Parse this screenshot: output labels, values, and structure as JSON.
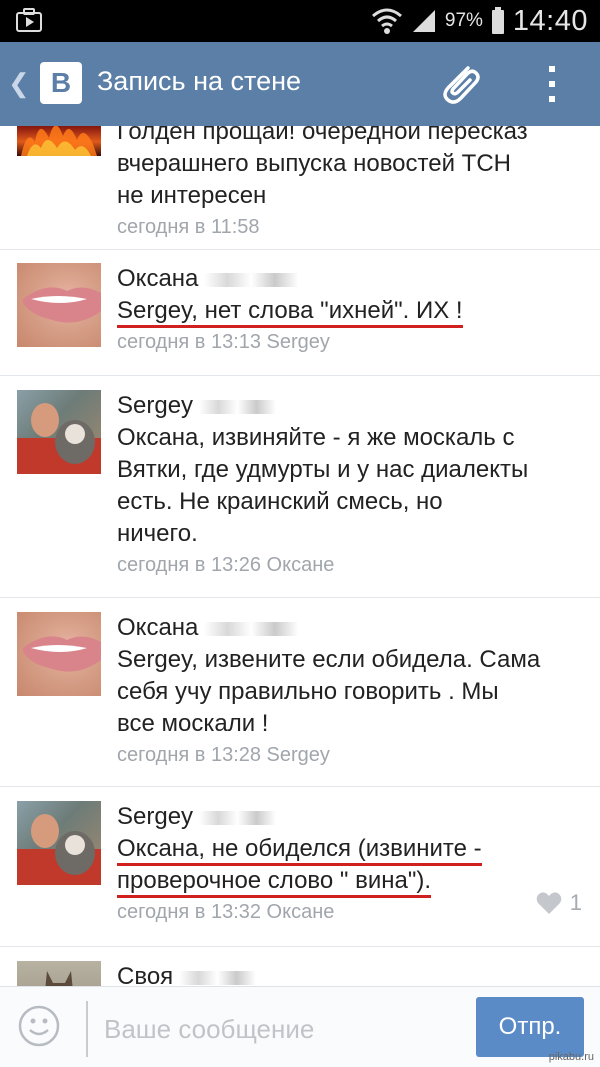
{
  "status_bar": {
    "battery": "97%",
    "time": "14:40"
  },
  "app_bar": {
    "back_glyph": "❮",
    "logo": "B",
    "title": "Запись на стене"
  },
  "comments": [
    {
      "author": "",
      "lines": [
        "Голден прощай! очередной пересказ",
        "вчерашнего выпуска новостей ТСН",
        "не интересен"
      ],
      "meta": "сегодня в 11:58",
      "avatar": "fire-avatar"
    },
    {
      "author": "Оксана",
      "lines": [
        "Sergey, нет слова \"ихней\". ИХ !"
      ],
      "meta": "сегодня в 13:13 Sergey",
      "avatar": "lips-avatar"
    },
    {
      "author": "Sergey",
      "lines": [
        "Оксана, извиняйте - я же москаль с",
        "Вятки, где удмурты и у нас диалекты",
        "есть. Не краинский смесь, но",
        "ничего."
      ],
      "meta": "сегодня в 13:26 Оксане",
      "avatar": "man-cat-avatar"
    },
    {
      "author": "Оксана",
      "lines": [
        "Sergey, извените если обидела. Сама",
        "себя учу правильно говорить . Мы",
        "все москали !"
      ],
      "meta": "сегодня в 13:28 Sergey",
      "avatar": "lips-avatar"
    },
    {
      "author": "Sergey",
      "lines": [
        "Оксана, не обиделся (извините -",
        "проверочное слово \" вина\")."
      ],
      "meta": "сегодня в 13:32 Оксане",
      "likes": "1",
      "avatar": "man-cat-avatar"
    },
    {
      "author": "Своя",
      "avatar": "cat-avatar"
    }
  ],
  "composer": {
    "placeholder": "Ваше сообщение",
    "send_label": "Отпр."
  },
  "watermark": "pikabu.ru",
  "colors": {
    "app_bar": "#5b7fa6",
    "send_button": "#5b8bc6",
    "underline": "#d0201f",
    "meta": "#a1a6ac"
  }
}
